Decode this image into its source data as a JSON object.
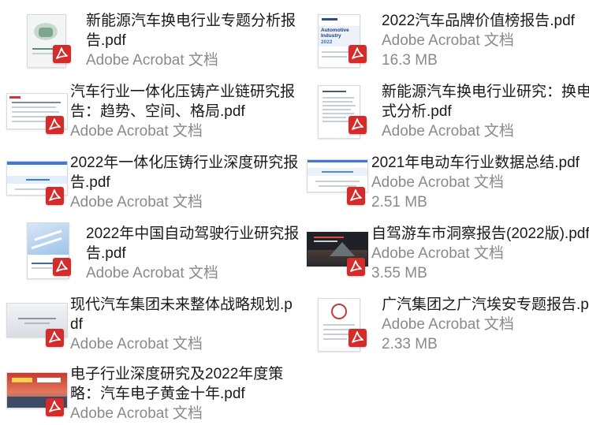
{
  "files": [
    {
      "name": "新能源汽车换电行业专题分析报告.pdf",
      "meta": "Adobe Acrobat 文档",
      "size": "",
      "thumb": "portrait-green",
      "badge_icon": "pdf-icon"
    },
    {
      "name": "2022汽车品牌价值榜报告.pdf",
      "meta": "Adobe Acrobat 文档",
      "size": "16.3 MB",
      "thumb": "portrait-automotive",
      "badge_icon": "pdf-icon",
      "thumb_text": [
        "Automotive",
        "Industry",
        "2022"
      ]
    },
    {
      "name": "汽车行业一体化压铸产业链研究报告：趋势、空间、格局.pdf",
      "meta": "Adobe Acrobat 文档",
      "size": "",
      "thumb": "landscape-table",
      "badge_icon": "pdf-icon"
    },
    {
      "name": "新能源汽车换电行业研究：换电模式分析.pdf",
      "meta": "Adobe Acrobat 文档",
      "size": "",
      "thumb": "portrait-text",
      "badge_icon": "pdf-icon"
    },
    {
      "name": "2022年一体化压铸行业深度研究报告.pdf",
      "meta": "Adobe Acrobat 文档",
      "size": "",
      "thumb": "landscape-blue",
      "badge_icon": "pdf-icon"
    },
    {
      "name": "2021年电动车行业数据总结.pdf",
      "meta": "Adobe Acrobat 文档",
      "size": "2.51 MB",
      "thumb": "landscape-blue2",
      "badge_icon": "pdf-icon"
    },
    {
      "name": "2022年中国自动驾驶行业研究报告.pdf",
      "meta": "Adobe Acrobat 文档",
      "size": "",
      "thumb": "portrait-blue",
      "badge_icon": "pdf-icon"
    },
    {
      "name": "自驾游车市洞察报告(2022版).pdf",
      "meta": "Adobe Acrobat 文档",
      "size": "3.55 MB",
      "thumb": "landscape-dark",
      "badge_icon": "pdf-icon"
    },
    {
      "name": "现代汽车集团未来整体战略规划.pdf",
      "meta": "Adobe Acrobat 文档",
      "size": "",
      "thumb": "landscape-grey",
      "badge_icon": "pdf-icon"
    },
    {
      "name": "广汽集团之广汽埃安专题报告.pdf",
      "meta": "Adobe Acrobat 文档",
      "size": "2.33 MB",
      "thumb": "portrait-red",
      "badge_icon": "pdf-icon"
    },
    {
      "name": "电子行业深度研究及2022年度策略：汽车电子黄金十年.pdf",
      "meta": "Adobe Acrobat 文档",
      "size": "",
      "thumb": "landscape-red",
      "badge_icon": "pdf-icon"
    }
  ],
  "colors": {
    "pdf_badge": "#d42b2b",
    "title_text": "#1a1a1a",
    "meta_text": "#8a8a8a"
  }
}
